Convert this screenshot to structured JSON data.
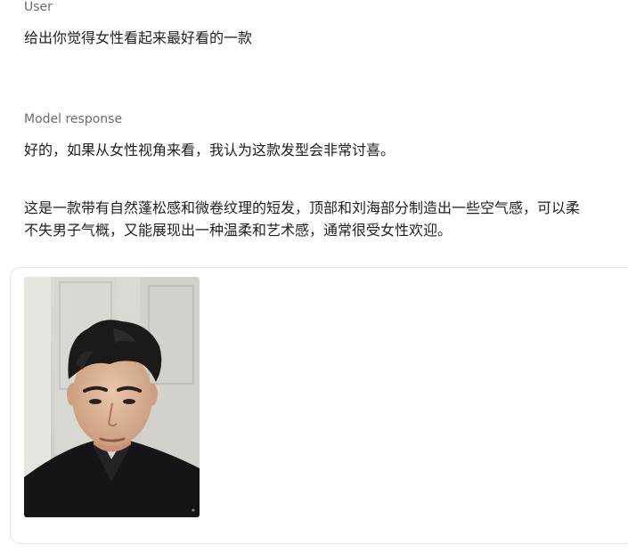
{
  "user": {
    "label": "User",
    "message": "给出你觉得女性看起来最好看的一款"
  },
  "model": {
    "label": "Model response",
    "paragraph1": "好的，如果从女性视角来看，我认为这款发型会非常讨喜。",
    "paragraph2_line1": "这是一款带有自然蓬松感和微卷纹理的短发，顶部和刘海部分制造出一些空气感，可以柔",
    "paragraph2_line2": "不失男子气概，又能展现出一种温柔和艺术感，通常很受女性欢迎。"
  },
  "attachment": {
    "kind": "photo",
    "subject": "portrait of a young man with short curly hair wearing a black shirt"
  },
  "colors": {
    "label": "#6b6b6b",
    "text": "#1f1f1f",
    "card_border": "#e1e3e6"
  }
}
